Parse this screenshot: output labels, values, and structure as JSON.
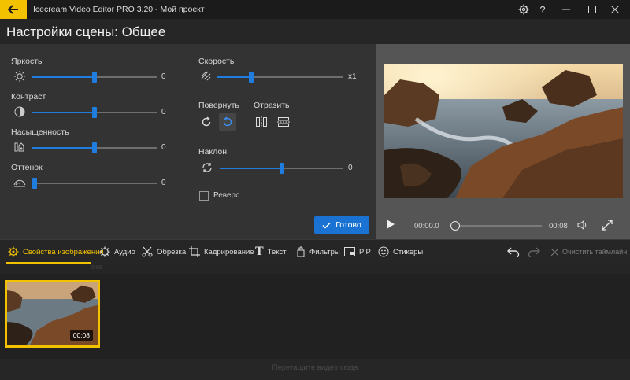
{
  "window": {
    "app_title": "Icecream Video Editor PRO 3.20  -  Мой проект",
    "icons": [
      "back-arrow-icon",
      "gear-icon",
      "help-icon",
      "minimize-icon",
      "maximize-icon",
      "close-icon"
    ]
  },
  "header": {
    "title": "Настройки сцены: Общее"
  },
  "settings": {
    "brightness": {
      "label": "Яркость",
      "value": "0",
      "level": 0.5
    },
    "contrast": {
      "label": "Контраст",
      "value": "0",
      "level": 0.5
    },
    "saturation": {
      "label": "Насыщенность",
      "value": "0",
      "level": 0.5
    },
    "hue": {
      "label": "Оттенок",
      "value": "0",
      "level": 0.0
    },
    "speed": {
      "label": "Скорость",
      "value": "x1",
      "level": 0.27
    },
    "rotate": {
      "label": "Повернуть"
    },
    "flip": {
      "label": "Отразить"
    },
    "tilt": {
      "label": "Наклон",
      "value": "0",
      "level": 0.5
    },
    "reverse": {
      "label": "Реверс",
      "checked": false
    },
    "done_label": "Готово"
  },
  "player": {
    "current_time": "00:00.0",
    "duration": "00:08",
    "progress": 0.0
  },
  "toolbar": {
    "items": [
      {
        "label": "Свойства изображения",
        "icon": "image-settings-icon",
        "active": true
      },
      {
        "label": "Аудио",
        "icon": "audio-gear-icon"
      },
      {
        "label": "Обрезка",
        "icon": "scissors-icon"
      },
      {
        "label": "Кадрирование",
        "icon": "crop-icon"
      },
      {
        "label": "Текст",
        "icon": "text-icon"
      },
      {
        "label": "Фильтры",
        "icon": "filter-icon"
      },
      {
        "label": "PiP",
        "icon": "pip-icon"
      },
      {
        "label": "Стикеры",
        "icon": "sticker-icon"
      }
    ],
    "clear_label": "Очистить таймлайн"
  },
  "timeline": {
    "ruler_mark": "0:00",
    "clip_duration": "00:08",
    "add_video_hint": "Перетащите видео сюда"
  },
  "colors": {
    "accent": "#f2c200",
    "primary": "#1a73d2"
  }
}
